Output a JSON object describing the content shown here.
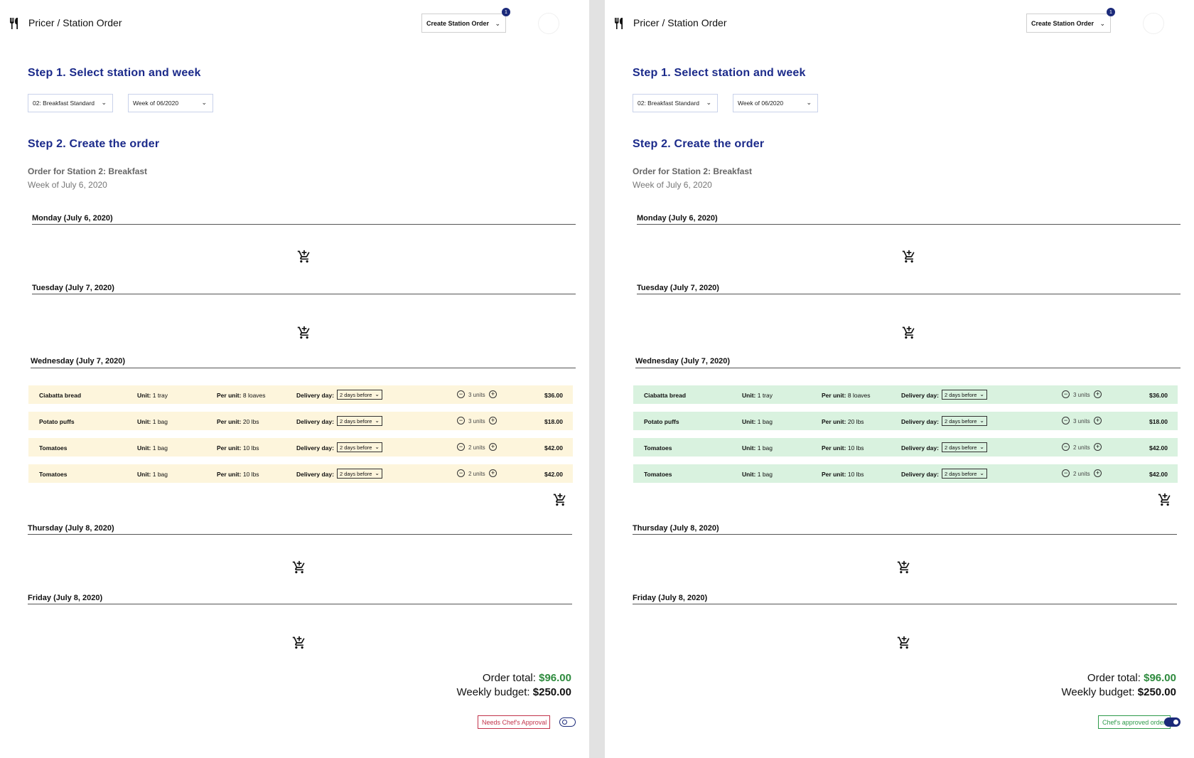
{
  "header": {
    "breadcrumb": "Pricer / Station Order",
    "create_button": "Create Station Order",
    "notification_count": "1"
  },
  "step1": {
    "title": "Step 1. Select station and week",
    "station_select": "02: Breakfast Standard",
    "week_select": "Week of 06/2020"
  },
  "step2": {
    "title": "Step 2. Create the order",
    "order_title": "Order for Station 2: Breakfast",
    "order_week": "Week of July 6, 2020"
  },
  "days": {
    "monday": "Monday (July 6, 2020)",
    "tuesday": "Tuesday (July 7, 2020)",
    "wednesday": "Wednesday (July 7, 2020)",
    "thursday": "Thursday (July 8, 2020)",
    "friday": "Friday (July 8, 2020)"
  },
  "labels": {
    "unit": "Unit:",
    "per_unit": "Per unit:",
    "delivery_day": "Delivery day:"
  },
  "items": [
    {
      "name": "Ciabatta bread",
      "unit": "1 tray",
      "per_unit": "8 loaves",
      "delivery": "2 days before",
      "qty": "3 units",
      "price": "$36.00"
    },
    {
      "name": "Potato puffs",
      "unit": "1 bag",
      "per_unit": "20 lbs",
      "delivery": "2 days before",
      "qty": "3 units",
      "price": "$18.00"
    },
    {
      "name": "Tomatoes",
      "unit": "1 bag",
      "per_unit": "10 lbs",
      "delivery": "2 days before",
      "qty": "2 units",
      "price": "$42.00"
    },
    {
      "name": "Tomatoes",
      "unit": "1 bag",
      "per_unit": "10 lbs",
      "delivery": "2 days before",
      "qty": "2 units",
      "price": "$42.00"
    }
  ],
  "totals": {
    "order_total_label": "Order total:",
    "order_total_value": "$96.00",
    "weekly_budget_label": "Weekly budget:",
    "weekly_budget_value": "$250.00"
  },
  "approval": {
    "left": {
      "badge": "Needs Chef's Approval",
      "toggle_on": false
    },
    "right": {
      "badge": "Chef's approved order!",
      "toggle_on": true
    }
  },
  "colors": {
    "accent": "#1b2a8a",
    "pending_row": "#fdf5dc",
    "approved_row": "#d9f2df",
    "total_green": "#2e8b3e",
    "needs_red": "#c2334a"
  },
  "icons": [
    "fork-knife-icon",
    "chevron-down-icon",
    "add-to-cart-icon",
    "minus-circle-icon",
    "plus-circle-icon"
  ]
}
